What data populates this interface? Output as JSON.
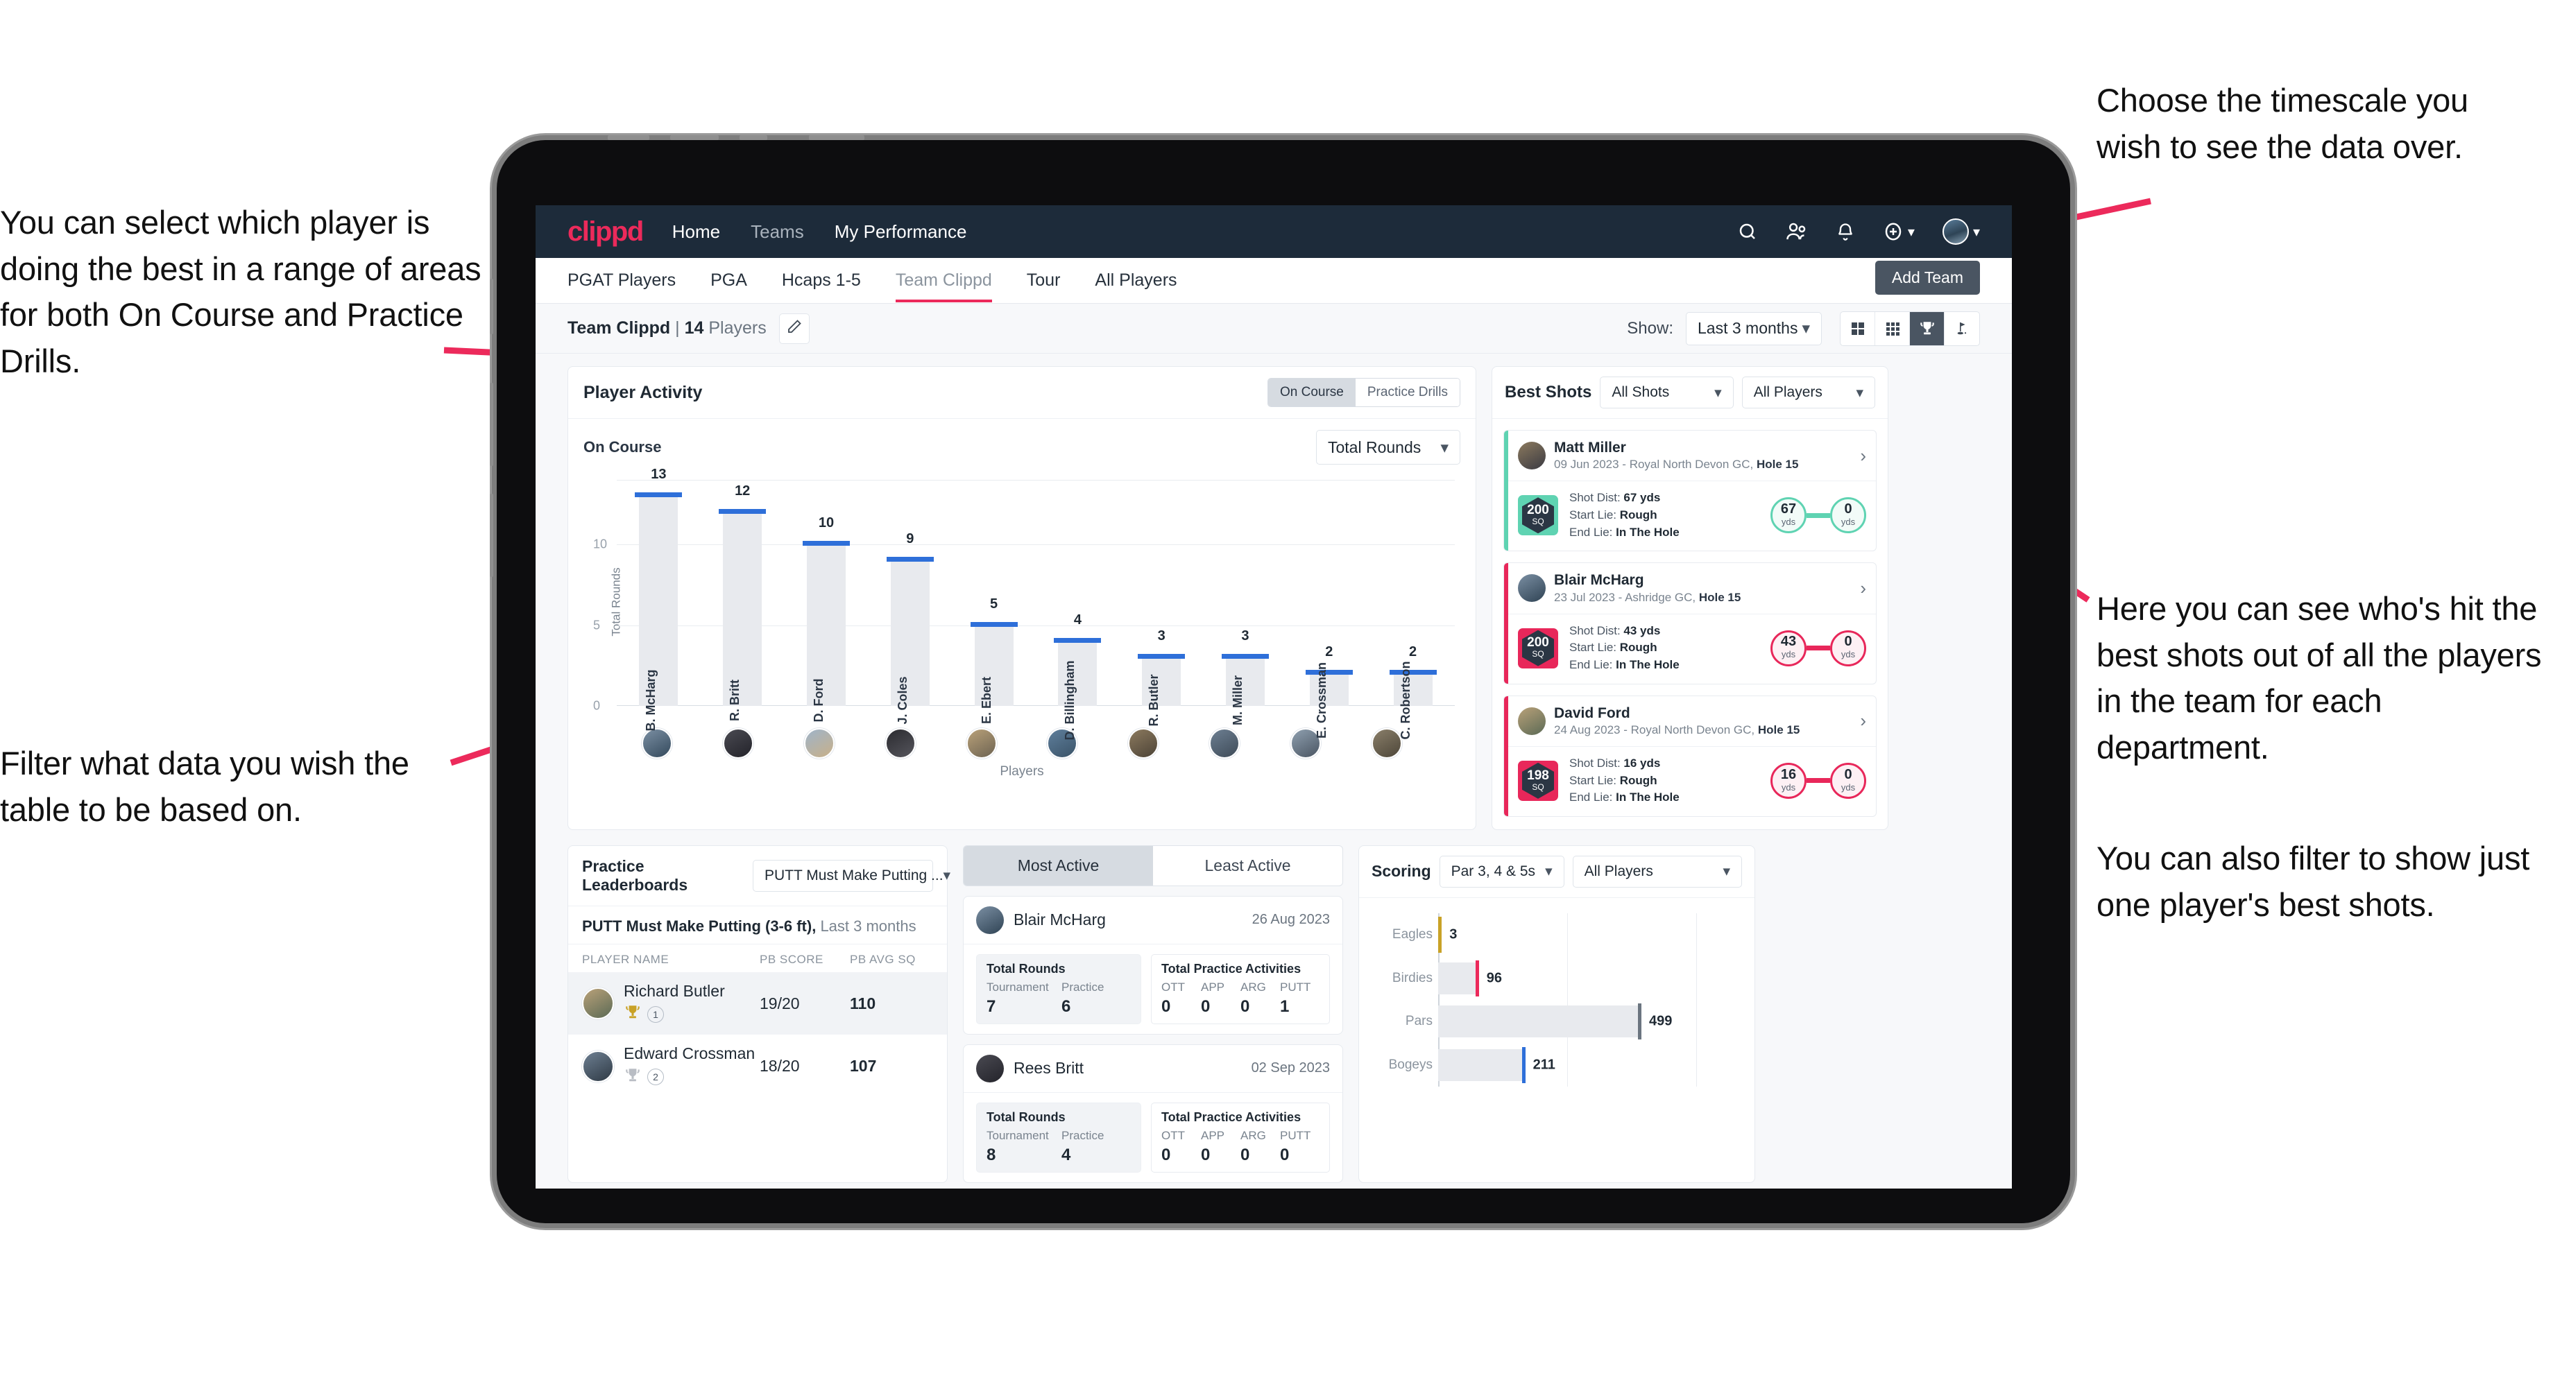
{
  "annotations": {
    "left_top": "You can select which player is doing the best in a range of areas for both On Course and Practice Drills.",
    "left_bottom": "Filter what data you wish the table to be based on.",
    "right_top": "Choose the timescale you wish to see the data over.",
    "right_mid": "Here you can see who's hit the best shots out of all the players in the team for each department.",
    "right_bottom": "You can also filter to show just one player's best shots."
  },
  "topnav": {
    "logo": "clippd",
    "links": [
      {
        "label": "Home",
        "active": true
      },
      {
        "label": "Teams",
        "active": false
      },
      {
        "label": "My Performance",
        "active": true
      }
    ],
    "icons": [
      "search-icon",
      "people-icon",
      "bell-icon",
      "plus-circle-icon",
      "avatar"
    ]
  },
  "tabs": [
    {
      "label": "PGAT Players",
      "active": false
    },
    {
      "label": "PGA",
      "active": false
    },
    {
      "label": "Hcaps 1-5",
      "active": false
    },
    {
      "label": "Team Clippd",
      "active": true
    },
    {
      "label": "Tour",
      "active": false
    },
    {
      "label": "All Players",
      "active": false
    }
  ],
  "add_team_button": "Add Team",
  "subbar": {
    "team_name": "Team Clippd",
    "separator": "|",
    "player_count": "14",
    "players_label": "Players",
    "show_label": "Show:",
    "period_value": "Last 3 months",
    "view_toggles": [
      {
        "name": "grid-large-icon",
        "active": false
      },
      {
        "name": "grid-small-icon",
        "active": false
      },
      {
        "name": "trophy-icon",
        "active": true
      },
      {
        "name": "flag-icon",
        "active": false
      }
    ]
  },
  "player_activity": {
    "title": "Player Activity",
    "segments": [
      {
        "label": "On Course",
        "active": true
      },
      {
        "label": "Practice Drills",
        "active": false
      }
    ],
    "sub_label": "On Course",
    "metric_value": "Total Rounds"
  },
  "best_shots": {
    "title": "Best Shots",
    "shot_filter": "All Shots",
    "player_filter": "All Players",
    "cards": [
      {
        "name": "Matt Miller",
        "meta_prefix": "09 Jun 2023 - Royal North Devon GC, ",
        "hole": "Hole 15",
        "badge_number": "200",
        "badge_unit": "SQ",
        "badge_color": "#5fd3b2",
        "shot_dist_label": "Shot Dist: ",
        "shot_dist": "67 yds",
        "start_lie_label": "Start Lie: ",
        "start_lie": "Rough",
        "end_lie_label": "End Lie: ",
        "end_lie": "In The Hole",
        "from_value": "67",
        "from_unit": "yds",
        "to_value": "0",
        "to_unit": "yds",
        "accent": "#5fd3b2"
      },
      {
        "name": "Blair McHarg",
        "meta_prefix": "23 Jul 2023 - Ashridge GC, ",
        "hole": "Hole 15",
        "badge_number": "200",
        "badge_unit": "SQ",
        "badge_color": "#e8275a",
        "shot_dist_label": "Shot Dist: ",
        "shot_dist": "43 yds",
        "start_lie_label": "Start Lie: ",
        "start_lie": "Rough",
        "end_lie_label": "End Lie: ",
        "end_lie": "In The Hole",
        "from_value": "43",
        "from_unit": "yds",
        "to_value": "0",
        "to_unit": "yds",
        "accent": "#e8275a"
      },
      {
        "name": "David Ford",
        "meta_prefix": "24 Aug 2023 - Royal North Devon GC, ",
        "hole": "Hole 15",
        "badge_number": "198",
        "badge_unit": "SQ",
        "badge_color": "#e8275a",
        "shot_dist_label": "Shot Dist: ",
        "shot_dist": "16 yds",
        "start_lie_label": "Start Lie: ",
        "start_lie": "Rough",
        "end_lie_label": "End Lie: ",
        "end_lie": "In The Hole",
        "from_value": "16",
        "from_unit": "yds",
        "to_value": "0",
        "to_unit": "yds",
        "accent": "#e8275a"
      }
    ]
  },
  "practice_leaderboards": {
    "title": "Practice Leaderboards",
    "drill_select": "PUTT Must Make Putting ...",
    "subtitle_bold": "PUTT Must Make Putting (3-6 ft),",
    "subtitle_light": " Last 3 months",
    "columns": [
      "PLAYER NAME",
      "PB SCORE",
      "PB AVG SQ"
    ],
    "rows": [
      {
        "name": "Richard Butler",
        "rank": "1",
        "trophy": "gold",
        "pb_score": "19/20",
        "pb_avg_sq": "110"
      },
      {
        "name": "Edward Crossman",
        "rank": "2",
        "trophy": "silver",
        "pb_score": "18/20",
        "pb_avg_sq": "107"
      }
    ]
  },
  "activity_panel": {
    "tabs": [
      {
        "label": "Most Active",
        "active": true
      },
      {
        "label": "Least Active",
        "active": false
      }
    ],
    "cards": [
      {
        "name": "Blair McHarg",
        "date": "26 Aug 2023",
        "rounds_title": "Total Rounds",
        "rounds": [
          {
            "key": "Tournament",
            "value": "7"
          },
          {
            "key": "Practice",
            "value": "6"
          }
        ],
        "practice_title": "Total Practice Activities",
        "practice": [
          {
            "key": "OTT",
            "value": "0"
          },
          {
            "key": "APP",
            "value": "0"
          },
          {
            "key": "ARG",
            "value": "0"
          },
          {
            "key": "PUTT",
            "value": "1"
          }
        ]
      },
      {
        "name": "Rees Britt",
        "date": "02 Sep 2023",
        "rounds_title": "Total Rounds",
        "rounds": [
          {
            "key": "Tournament",
            "value": "8"
          },
          {
            "key": "Practice",
            "value": "4"
          }
        ],
        "practice_title": "Total Practice Activities",
        "practice": [
          {
            "key": "OTT",
            "value": "0"
          },
          {
            "key": "APP",
            "value": "0"
          },
          {
            "key": "ARG",
            "value": "0"
          },
          {
            "key": "PUTT",
            "value": "0"
          }
        ]
      }
    ]
  },
  "scoring": {
    "title": "Scoring",
    "par_filter": "Par 3, 4 & 5s",
    "player_filter": "All Players"
  },
  "chart_data": [
    {
      "type": "bar",
      "title": "Player Activity - On Course",
      "xlabel": "Players",
      "ylabel": "Total Rounds",
      "categories": [
        "B. McHarg",
        "R. Britt",
        "D. Ford",
        "J. Coles",
        "E. Ebert",
        "D. Billingham",
        "R. Butler",
        "M. Miller",
        "E. Crossman",
        "C. Robertson"
      ],
      "values": [
        13,
        12,
        10,
        9,
        5,
        4,
        3,
        3,
        2,
        2
      ],
      "ylim": [
        0,
        14
      ],
      "yticks": [
        0,
        5,
        10
      ],
      "grid": true,
      "bar_color": "#e8eaee",
      "cap_color": "#2e6fd9"
    },
    {
      "type": "bar",
      "orientation": "horizontal",
      "title": "Scoring",
      "categories": [
        "Eagles",
        "Birdies",
        "Pars",
        "Bogeys"
      ],
      "values": [
        3,
        96,
        499,
        211
      ],
      "xlim": [
        0,
        640
      ],
      "grid": true,
      "bar_color": "#e8eaee",
      "tip_colors": [
        "#c9a227",
        "#ec2a5b",
        "#6b7580",
        "#2e6fd9"
      ]
    }
  ],
  "colors": {
    "brand_pink": "#ec2a5b",
    "nav_dark": "#1d2b3a",
    "teal": "#5fd3b2",
    "blue": "#2e6fd9",
    "page_bg": "#f7f8fa"
  }
}
